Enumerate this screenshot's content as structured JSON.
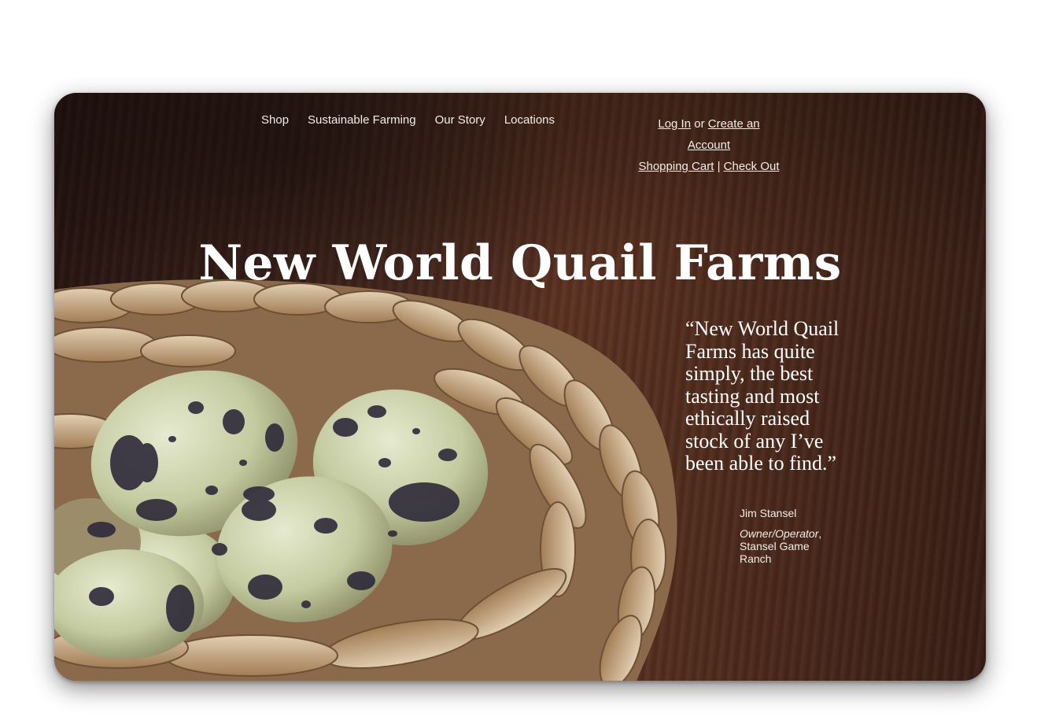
{
  "nav": {
    "items": [
      "Shop",
      "Sustainable Farming",
      "Our Story",
      "Locations"
    ]
  },
  "account": {
    "login": "Log In",
    "or": "or",
    "create": "Create an Account",
    "cart": "Shopping Cart",
    "separator": "|",
    "checkout": "Check Out"
  },
  "hero": {
    "title": "New World Quail Farms"
  },
  "testimonial": {
    "quote": "“New World Quail Farms has quite simply, the best tasting and most ethically raised stock of any I’ve been able to find.”",
    "name": "Jim Stansel",
    "role_title": "Owner/Operator",
    "role_org": "Stansel Game Ranch"
  },
  "colors": {
    "background": "#ffffff",
    "text": "#ffffff",
    "wood": "#5e3322",
    "egg": "#c9d0a4",
    "speckle": "#2e2a3a",
    "straw": "#c9ab80"
  },
  "image": {
    "subject": "quail-eggs-in-woven-basket"
  }
}
